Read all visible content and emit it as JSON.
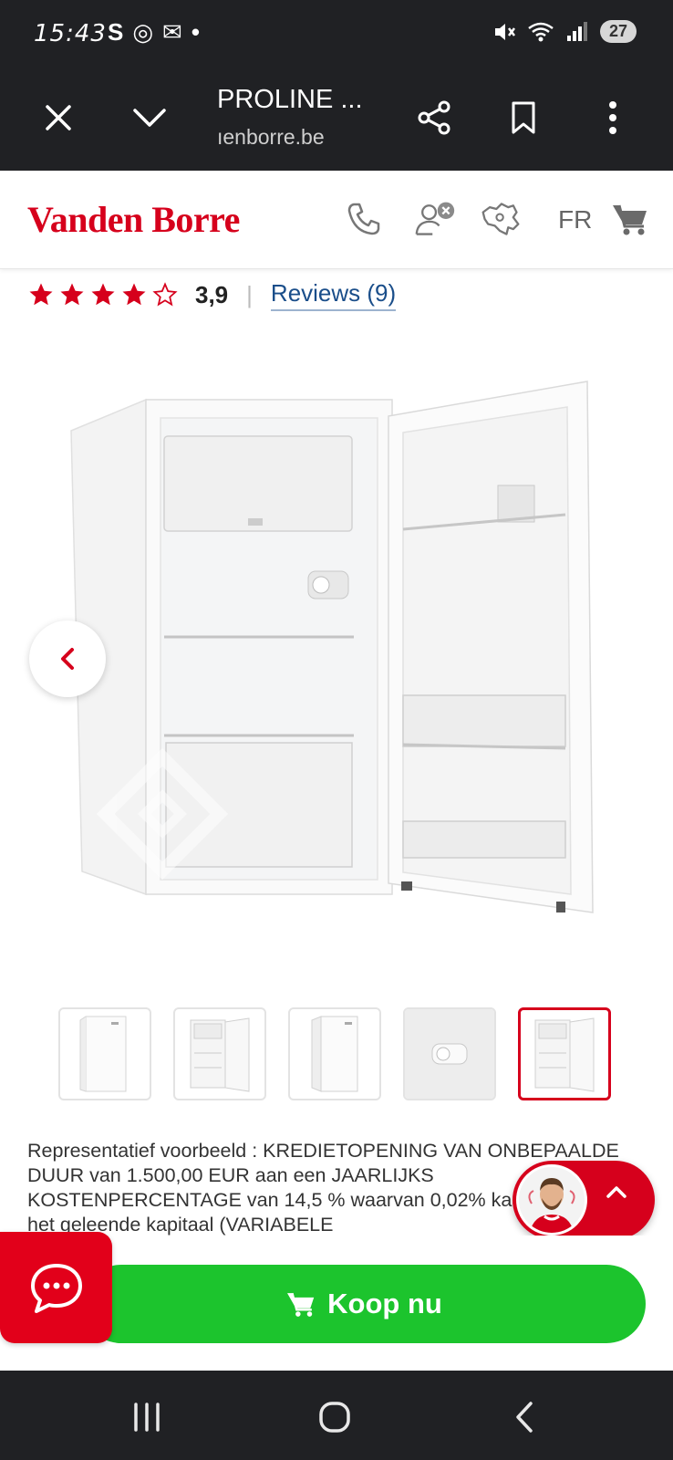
{
  "status_bar": {
    "time": "15:43",
    "left_icons": [
      "S",
      "◎",
      "✉",
      "•"
    ],
    "battery": "27"
  },
  "browser": {
    "title": "PROLINE ...",
    "url": "ıenborre.be",
    "icons": [
      "close-icon",
      "chevron-down-icon",
      "share-icon",
      "bookmark-icon",
      "more-vertical-icon"
    ]
  },
  "site_header": {
    "logo": "Vanden Borre",
    "language": "FR",
    "icons": [
      "phone-icon",
      "user-unavailable-icon",
      "map-belgium-icon",
      "cart-icon"
    ]
  },
  "rating": {
    "value": "3,9",
    "stars_filled": 4,
    "stars_total": 5,
    "separator": "|",
    "reviews_label": "Reviews (9)"
  },
  "gallery": {
    "thumbnail_count": 5,
    "active_index": 4,
    "image_alt": "refrigerator"
  },
  "legal_text": "Representatief voorbeeld : KREDIETOPENING VAN ONBEPAALDE DUUR van 1.500,00 EUR aan een JAARLIJKS KOSTENPERCENTAGE van 14,5 % waarvan 0,02% kaartkosten van het geleende kapitaal (VARIABELE",
  "buy_button": {
    "label": "Koop nu"
  },
  "colors": {
    "brand_red": "#d6001c",
    "buy_green": "#1cc42d",
    "link_blue": "#1a4e8a",
    "chrome_dark": "#202124"
  }
}
